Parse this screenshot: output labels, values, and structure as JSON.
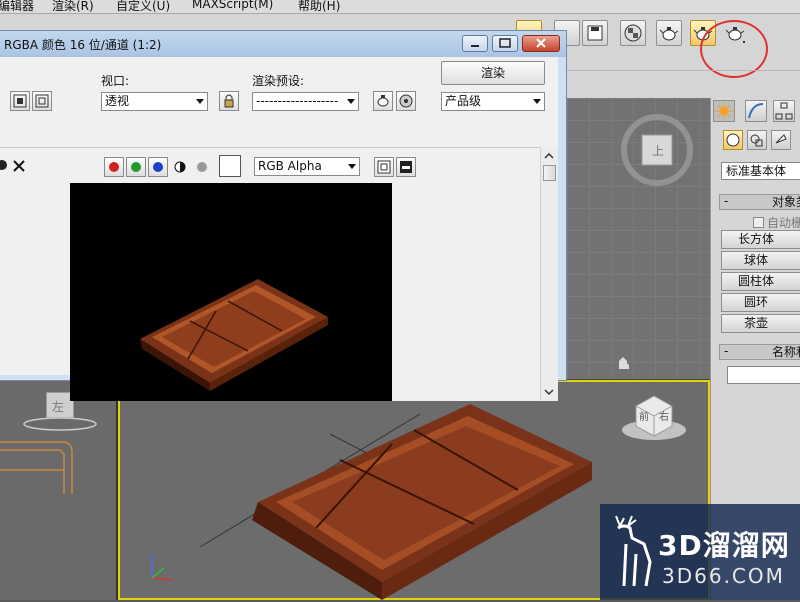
{
  "menu": {
    "items": [
      "编辑器",
      "渲染(R)",
      "自定义(U)",
      "MAXScript(M)",
      "帮助(H)"
    ]
  },
  "render_window": {
    "title": "RGBA 颜色 16 位/通道 (1:2)",
    "viewport_label": "视口:",
    "viewport_value": "透视",
    "preset_label": "渲染预设:",
    "preset_value": "-------------------",
    "render_button": "渲染",
    "quality_value": "产品级",
    "channel_value": "RGB Alpha",
    "color_buttons": [
      "red",
      "green",
      "blue"
    ]
  },
  "viewports": {
    "top_label": "上",
    "left_label": "左",
    "persp_cube_faces": [
      "前",
      "右"
    ]
  },
  "command_panel": {
    "category": "标准基本体",
    "object_type_rollout": "对象类型",
    "autogrid": "自动栅格",
    "objects": [
      "长方体",
      "球体",
      "圆柱体",
      "圆环",
      "茶壶"
    ],
    "name_rollout": "名称和颜色"
  },
  "watermark": {
    "brand": "3D溜溜网",
    "domain": "3D66.COM"
  },
  "colors": {
    "chocolate": "#8b3c1f",
    "highlight_circle": "#e03030",
    "active_viewport": "#e6d400"
  },
  "icons": {
    "render_teapot": "teapot-icon",
    "lock": "lock-icon",
    "close": "close-icon",
    "save": "save-icon"
  }
}
